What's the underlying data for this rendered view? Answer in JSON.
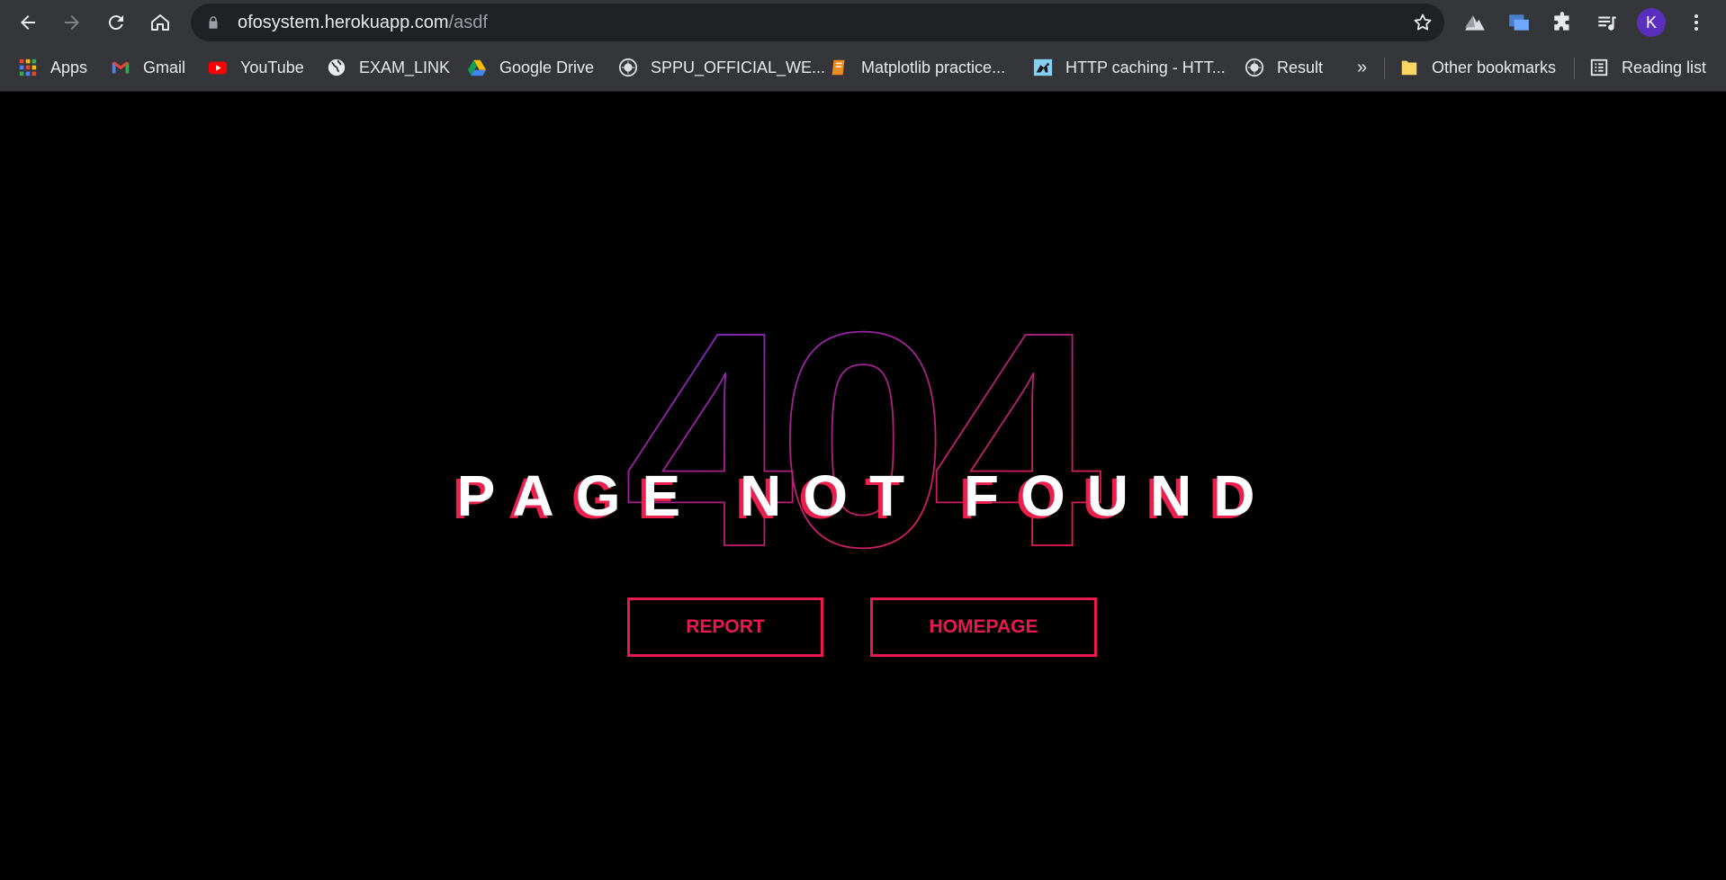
{
  "browser": {
    "url_host": "ofosystem.herokuapp.com",
    "url_path": "/asdf",
    "profile_initial": "K",
    "bookmarks": [
      {
        "label": "Apps",
        "icon": "apps-grid-icon"
      },
      {
        "label": "Gmail",
        "icon": "gmail-icon"
      },
      {
        "label": "YouTube",
        "icon": "youtube-icon"
      },
      {
        "label": "EXAM_LINK",
        "icon": "globe-icon"
      },
      {
        "label": "Google Drive",
        "icon": "google-drive-icon"
      },
      {
        "label": "SPPU_OFFICIAL_WE...",
        "icon": "university-seal-icon"
      },
      {
        "label": "Matplotlib practice...",
        "icon": "notebook-icon"
      },
      {
        "label": "HTTP caching - HTT...",
        "icon": "mdn-dino-icon"
      },
      {
        "label": "Result",
        "icon": "university-seal-icon"
      }
    ],
    "overflow_label": "»",
    "other_bookmarks": "Other bookmarks",
    "reading_list": "Reading list"
  },
  "page": {
    "code": "404",
    "headline": "PAGE NOT FOUND",
    "report_button": "REPORT",
    "homepage_button": "HOMEPAGE"
  },
  "colors": {
    "accent": "#e8194e",
    "outline_purple": "#7b2ff7",
    "background": "#000000"
  }
}
